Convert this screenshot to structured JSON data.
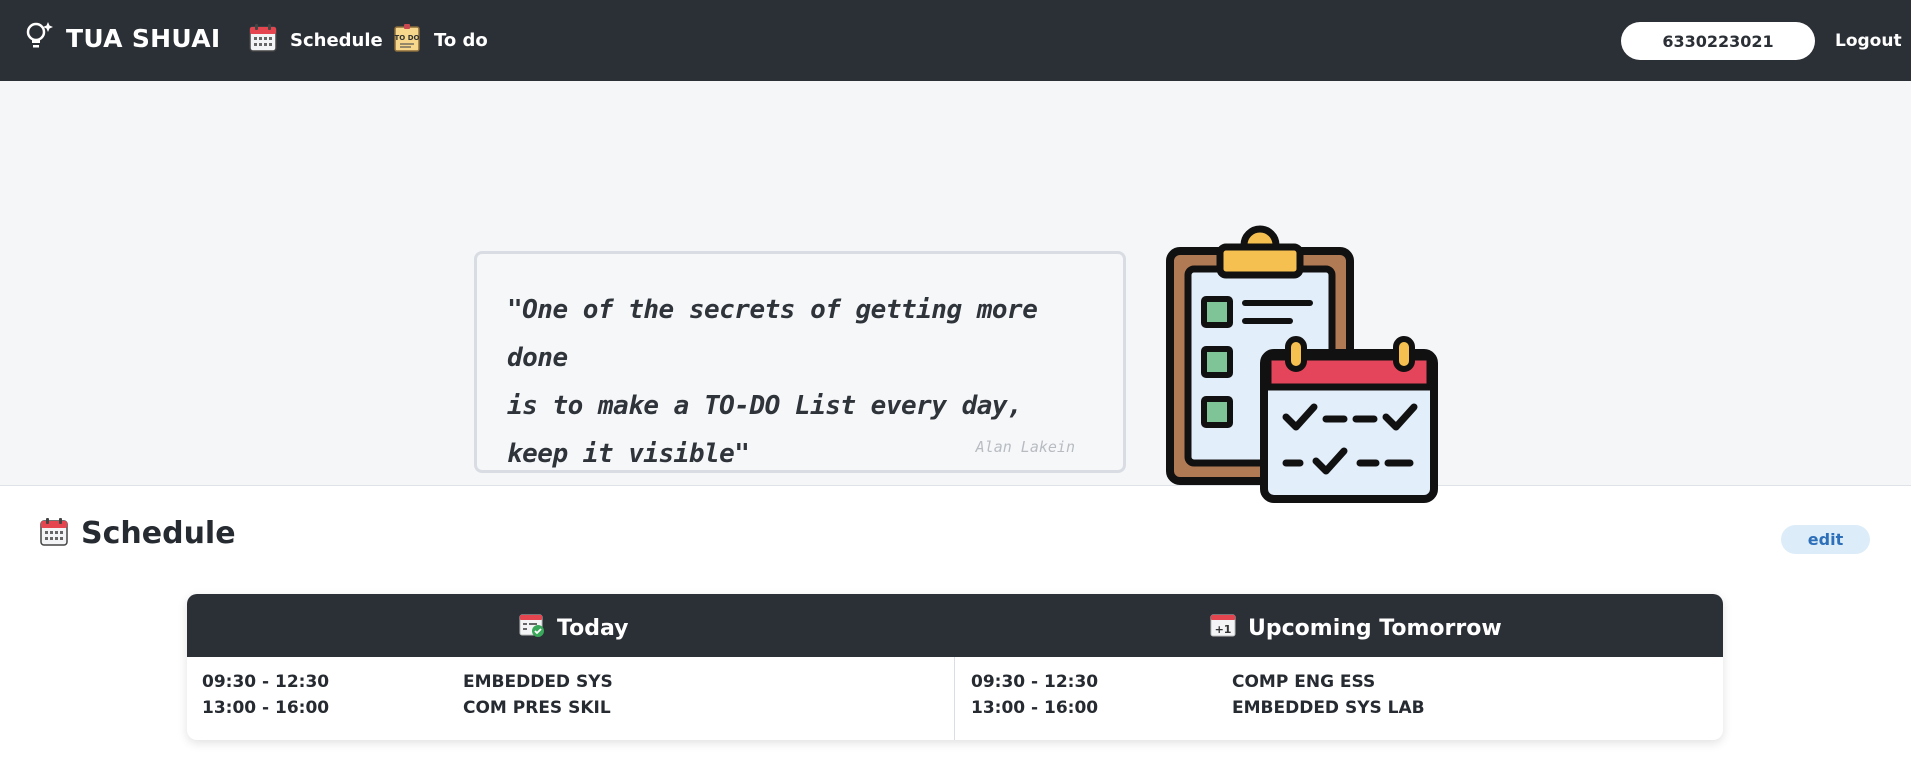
{
  "nav": {
    "brand": "TUA SHUAI",
    "brand_icon": "lightbulb-icon",
    "schedule_label": "Schedule",
    "todo_label": "To do",
    "user_id": "6330223021",
    "logout_label": "Logout"
  },
  "hero": {
    "quote_lines": [
      "\"One of the secrets of getting more done",
      "is to make a TO-DO List every day,",
      "keep it visible\""
    ],
    "author": "Alan Lakein",
    "illustration_icon": "clipboard-calendar-icon"
  },
  "schedule": {
    "title": "Schedule",
    "edit_label": "edit",
    "today_title": "Today",
    "tomorrow_title": "Upcoming Tomorrow",
    "today": [
      {
        "time": "09:30 - 12:30",
        "subject": "EMBEDDED SYS"
      },
      {
        "time": "13:00 - 16:00",
        "subject": "COM PRES SKIL"
      }
    ],
    "tomorrow": [
      {
        "time": "09:30 - 12:30",
        "subject": "COMP ENG ESS"
      },
      {
        "time": "13:00 - 16:00",
        "subject": "EMBEDDED SYS LAB"
      }
    ]
  },
  "colors": {
    "navbar": "#2b2f36",
    "hero_bg": "#f5f6f8",
    "edit_bg": "#dcecf9",
    "edit_text": "#2d6fb9"
  }
}
